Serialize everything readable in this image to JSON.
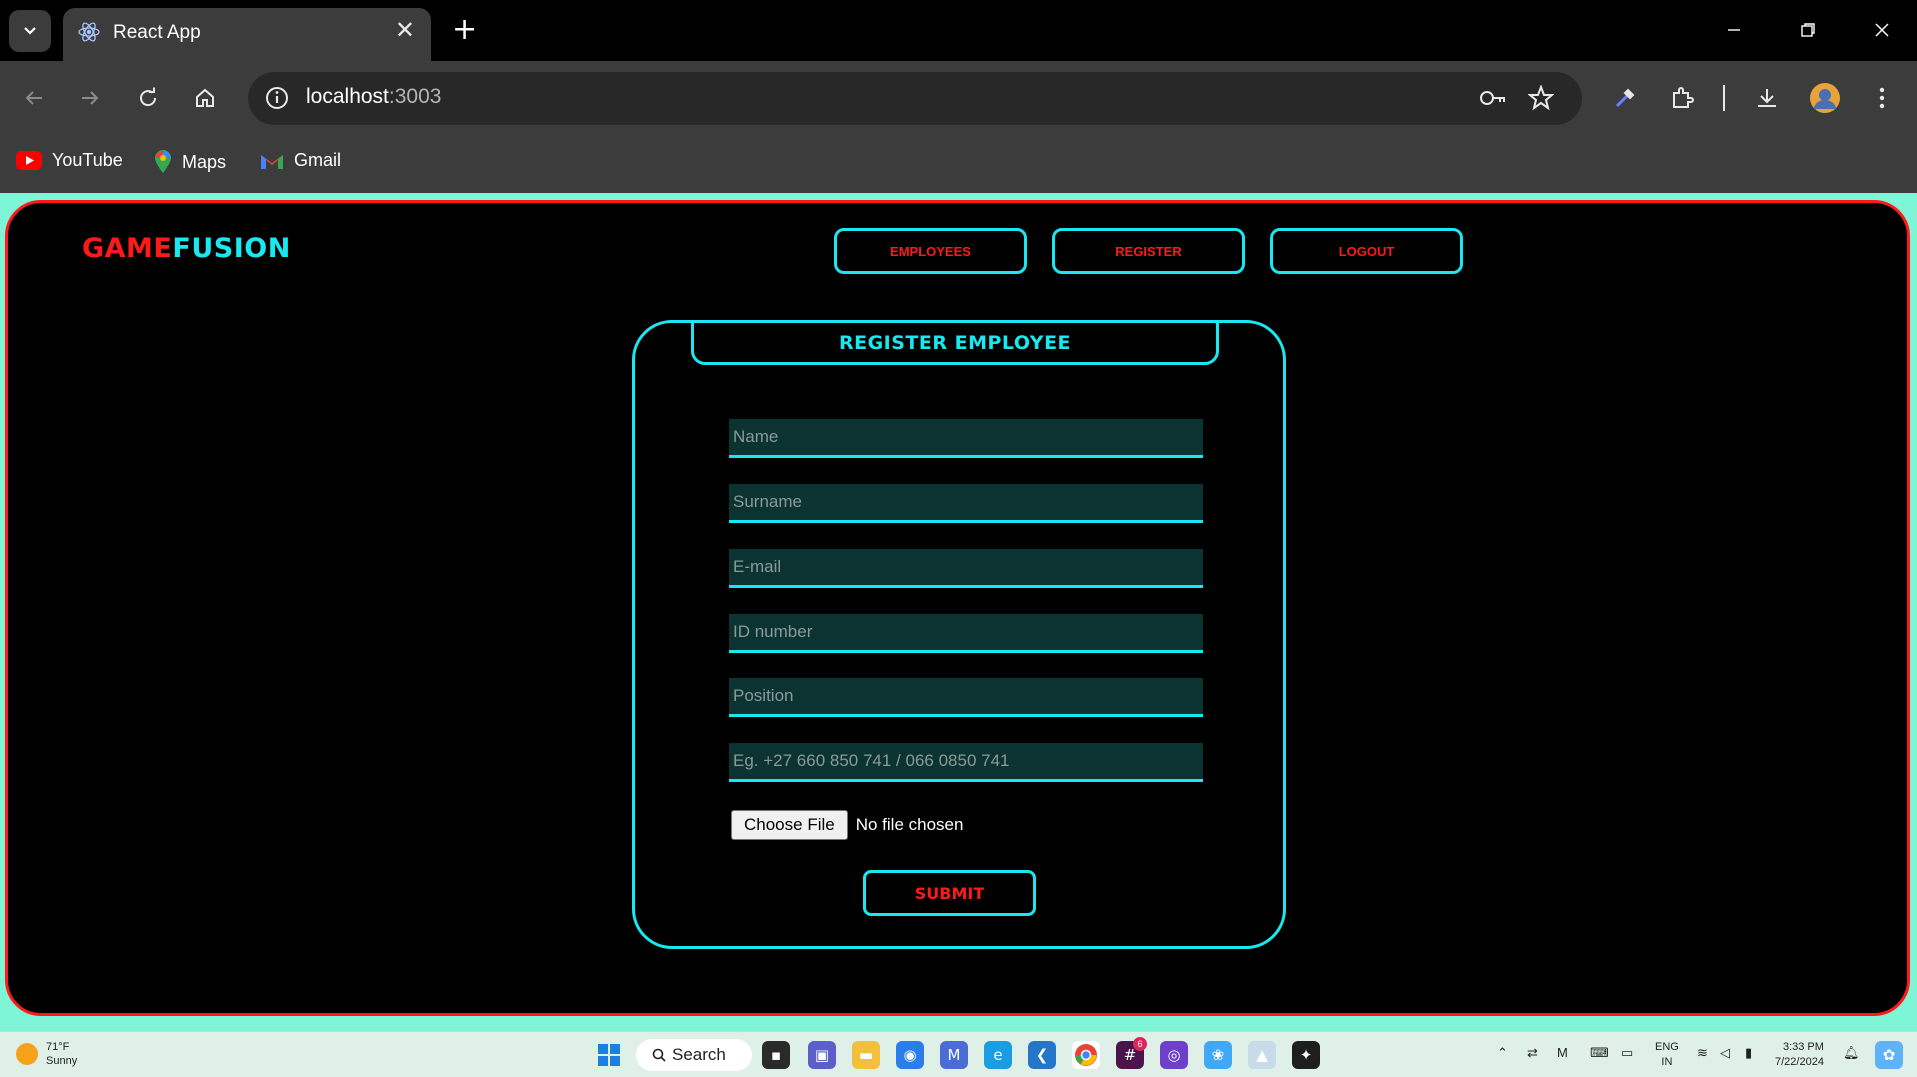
{
  "browser": {
    "tab_title": "React App",
    "url_host": "localhost",
    "url_port": ":3003",
    "bookmarks": [
      "YouTube",
      "Maps",
      "Gmail"
    ]
  },
  "app": {
    "logo_part1": "GAME",
    "logo_part2": "FUSION",
    "nav": [
      "EMPLOYEES",
      "REGISTER",
      "LOGOUT"
    ],
    "colors": {
      "accent_cyan": "#19e8f0",
      "accent_red": "#ff1a1a",
      "page_bg": "#7ff5d8",
      "field_bg": "#0b3331"
    }
  },
  "form": {
    "title": "REGISTER EMPLOYEE",
    "fields": [
      {
        "placeholder": "Name"
      },
      {
        "placeholder": "Surname"
      },
      {
        "placeholder": "E-mail"
      },
      {
        "placeholder": "ID number"
      },
      {
        "placeholder": "Position"
      },
      {
        "placeholder": "Eg. +27 660 850 741 / 066 0850 741"
      }
    ],
    "file_button": "Choose File",
    "file_status": "No file chosen",
    "submit_label": "SUBMIT"
  },
  "taskbar": {
    "temperature": "71°F",
    "condition": "Sunny",
    "search_label": "Search",
    "lang_line1": "ENG",
    "lang_line2": "IN",
    "time": "3:33 PM",
    "date": "7/22/2024",
    "slack_badge": "6"
  }
}
